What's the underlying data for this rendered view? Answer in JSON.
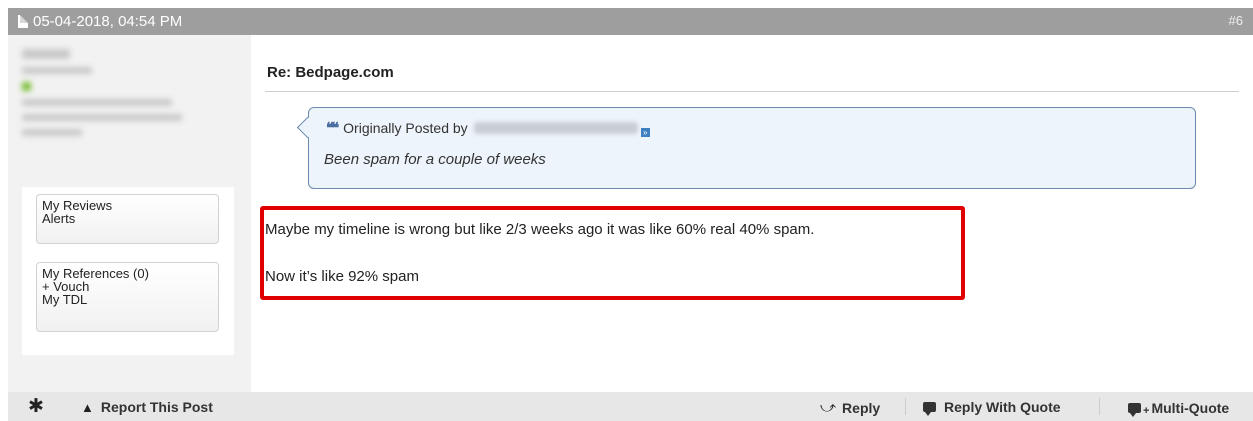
{
  "post": {
    "date": "05-04-2018, 04:54 PM",
    "number": "#6",
    "title": "Re: Bedpage.com"
  },
  "user": {
    "links_box1": [
      "My Reviews",
      "Alerts"
    ],
    "links_box2": [
      "My References (0)",
      "+ Vouch",
      "My TDL"
    ]
  },
  "quote": {
    "prefix": "Originally Posted by",
    "text": "Been spam for a couple of weeks"
  },
  "message": {
    "lines": [
      "Maybe my timeline is wrong but like 2/3 weeks ago it was like 60% real 40% spam.",
      "Now it’s like 92% spam"
    ],
    "highlight_color": "#e00000"
  },
  "footer": {
    "report": "Report This Post",
    "reply": "Reply",
    "reply_with_quote": "Reply With Quote",
    "multi_quote": "Multi-Quote"
  },
  "icons": [
    "document-icon",
    "quote-icon",
    "jump-to-post-icon",
    "star-icon",
    "warning-icon",
    "reply-icon",
    "speech-bubble-icon",
    "multi-quote-icon"
  ],
  "colors": {
    "header_bg": "#9e9e9e",
    "quote_border": "#6a8ab0",
    "quote_bg": "#eef4fb"
  }
}
